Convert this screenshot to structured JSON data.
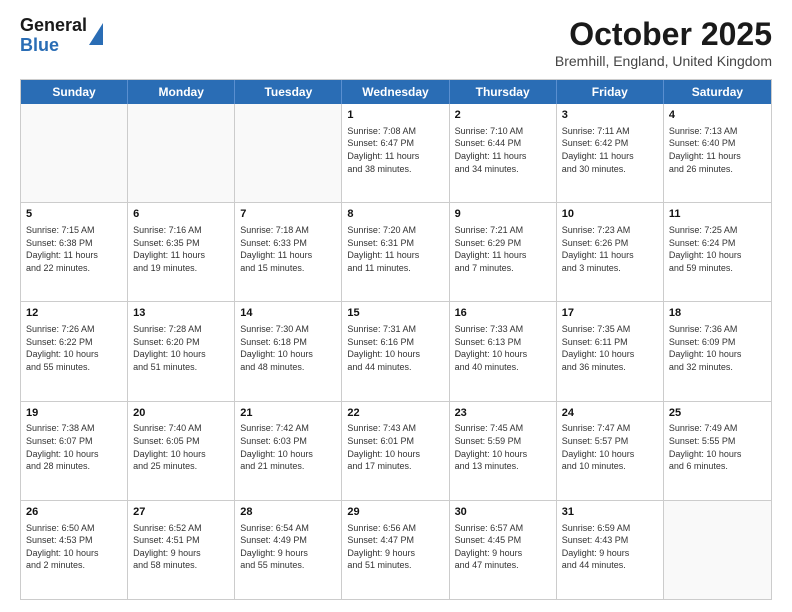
{
  "header": {
    "logo_line1": "General",
    "logo_line2": "Blue",
    "title": "October 2025",
    "subtitle": "Bremhill, England, United Kingdom"
  },
  "calendar": {
    "days_of_week": [
      "Sunday",
      "Monday",
      "Tuesday",
      "Wednesday",
      "Thursday",
      "Friday",
      "Saturday"
    ],
    "rows": [
      [
        {
          "day": "",
          "info": ""
        },
        {
          "day": "",
          "info": ""
        },
        {
          "day": "",
          "info": ""
        },
        {
          "day": "1",
          "info": "Sunrise: 7:08 AM\nSunset: 6:47 PM\nDaylight: 11 hours\nand 38 minutes."
        },
        {
          "day": "2",
          "info": "Sunrise: 7:10 AM\nSunset: 6:44 PM\nDaylight: 11 hours\nand 34 minutes."
        },
        {
          "day": "3",
          "info": "Sunrise: 7:11 AM\nSunset: 6:42 PM\nDaylight: 11 hours\nand 30 minutes."
        },
        {
          "day": "4",
          "info": "Sunrise: 7:13 AM\nSunset: 6:40 PM\nDaylight: 11 hours\nand 26 minutes."
        }
      ],
      [
        {
          "day": "5",
          "info": "Sunrise: 7:15 AM\nSunset: 6:38 PM\nDaylight: 11 hours\nand 22 minutes."
        },
        {
          "day": "6",
          "info": "Sunrise: 7:16 AM\nSunset: 6:35 PM\nDaylight: 11 hours\nand 19 minutes."
        },
        {
          "day": "7",
          "info": "Sunrise: 7:18 AM\nSunset: 6:33 PM\nDaylight: 11 hours\nand 15 minutes."
        },
        {
          "day": "8",
          "info": "Sunrise: 7:20 AM\nSunset: 6:31 PM\nDaylight: 11 hours\nand 11 minutes."
        },
        {
          "day": "9",
          "info": "Sunrise: 7:21 AM\nSunset: 6:29 PM\nDaylight: 11 hours\nand 7 minutes."
        },
        {
          "day": "10",
          "info": "Sunrise: 7:23 AM\nSunset: 6:26 PM\nDaylight: 11 hours\nand 3 minutes."
        },
        {
          "day": "11",
          "info": "Sunrise: 7:25 AM\nSunset: 6:24 PM\nDaylight: 10 hours\nand 59 minutes."
        }
      ],
      [
        {
          "day": "12",
          "info": "Sunrise: 7:26 AM\nSunset: 6:22 PM\nDaylight: 10 hours\nand 55 minutes."
        },
        {
          "day": "13",
          "info": "Sunrise: 7:28 AM\nSunset: 6:20 PM\nDaylight: 10 hours\nand 51 minutes."
        },
        {
          "day": "14",
          "info": "Sunrise: 7:30 AM\nSunset: 6:18 PM\nDaylight: 10 hours\nand 48 minutes."
        },
        {
          "day": "15",
          "info": "Sunrise: 7:31 AM\nSunset: 6:16 PM\nDaylight: 10 hours\nand 44 minutes."
        },
        {
          "day": "16",
          "info": "Sunrise: 7:33 AM\nSunset: 6:13 PM\nDaylight: 10 hours\nand 40 minutes."
        },
        {
          "day": "17",
          "info": "Sunrise: 7:35 AM\nSunset: 6:11 PM\nDaylight: 10 hours\nand 36 minutes."
        },
        {
          "day": "18",
          "info": "Sunrise: 7:36 AM\nSunset: 6:09 PM\nDaylight: 10 hours\nand 32 minutes."
        }
      ],
      [
        {
          "day": "19",
          "info": "Sunrise: 7:38 AM\nSunset: 6:07 PM\nDaylight: 10 hours\nand 28 minutes."
        },
        {
          "day": "20",
          "info": "Sunrise: 7:40 AM\nSunset: 6:05 PM\nDaylight: 10 hours\nand 25 minutes."
        },
        {
          "day": "21",
          "info": "Sunrise: 7:42 AM\nSunset: 6:03 PM\nDaylight: 10 hours\nand 21 minutes."
        },
        {
          "day": "22",
          "info": "Sunrise: 7:43 AM\nSunset: 6:01 PM\nDaylight: 10 hours\nand 17 minutes."
        },
        {
          "day": "23",
          "info": "Sunrise: 7:45 AM\nSunset: 5:59 PM\nDaylight: 10 hours\nand 13 minutes."
        },
        {
          "day": "24",
          "info": "Sunrise: 7:47 AM\nSunset: 5:57 PM\nDaylight: 10 hours\nand 10 minutes."
        },
        {
          "day": "25",
          "info": "Sunrise: 7:49 AM\nSunset: 5:55 PM\nDaylight: 10 hours\nand 6 minutes."
        }
      ],
      [
        {
          "day": "26",
          "info": "Sunrise: 6:50 AM\nSunset: 4:53 PM\nDaylight: 10 hours\nand 2 minutes."
        },
        {
          "day": "27",
          "info": "Sunrise: 6:52 AM\nSunset: 4:51 PM\nDaylight: 9 hours\nand 58 minutes."
        },
        {
          "day": "28",
          "info": "Sunrise: 6:54 AM\nSunset: 4:49 PM\nDaylight: 9 hours\nand 55 minutes."
        },
        {
          "day": "29",
          "info": "Sunrise: 6:56 AM\nSunset: 4:47 PM\nDaylight: 9 hours\nand 51 minutes."
        },
        {
          "day": "30",
          "info": "Sunrise: 6:57 AM\nSunset: 4:45 PM\nDaylight: 9 hours\nand 47 minutes."
        },
        {
          "day": "31",
          "info": "Sunrise: 6:59 AM\nSunset: 4:43 PM\nDaylight: 9 hours\nand 44 minutes."
        },
        {
          "day": "",
          "info": ""
        }
      ]
    ]
  }
}
